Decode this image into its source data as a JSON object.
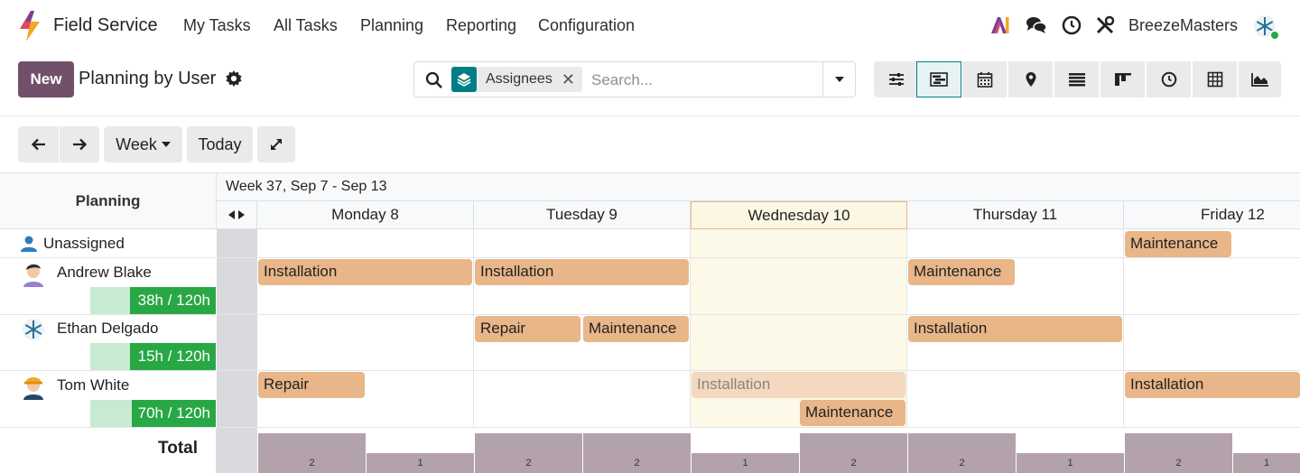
{
  "app": {
    "name": "Field Service",
    "company": "BreezeMasters"
  },
  "menu": [
    "My Tasks",
    "All Tasks",
    "Planning",
    "Reporting",
    "Configuration"
  ],
  "control": {
    "new_label": "New",
    "title": "Planning by User",
    "facet_label": "Assignees",
    "search_placeholder": "Search..."
  },
  "toolbar": {
    "week_label": "Week",
    "today_label": "Today"
  },
  "gantt": {
    "left_header": "Planning",
    "range": "Week 37, Sep 7 - Sep 13",
    "days": [
      "Monday 8",
      "Tuesday 9",
      "Wednesday 10",
      "Thursday 11",
      "Friday 12"
    ],
    "rows": [
      {
        "name": "Unassigned"
      },
      {
        "name": "Andrew Blake",
        "workload": "38h / 120h",
        "fill": 0.68
      },
      {
        "name": "Ethan Delgado",
        "workload": "15h / 120h",
        "fill": 0.68
      },
      {
        "name": "Tom White",
        "workload": "70h / 120h",
        "fill": 0.67
      }
    ],
    "pills": {
      "p0": "Maintenance",
      "p1": "Installation",
      "p2": "Installation",
      "p3": "Maintenance",
      "p4": "Repair",
      "p5": "Maintenance",
      "p6": "Installation",
      "p7": "Repair",
      "p8": "Installation",
      "p9": "Installation",
      "p10": "Maintenance"
    },
    "total_label": "Total",
    "totals": [
      "2",
      "1",
      "2",
      "2",
      "1",
      "2",
      "2",
      "1",
      "2",
      "1"
    ]
  },
  "colors": {
    "brand": "#71506b",
    "accent": "#017e84",
    "pill": "#e8b688",
    "progress": "#28a745"
  }
}
